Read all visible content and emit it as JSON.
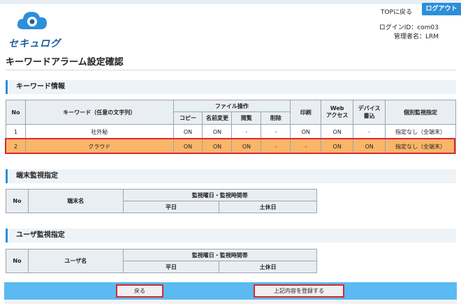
{
  "header": {
    "logo_text": "セキュログ",
    "top_link": "TOPに戻る",
    "logout": "ログアウト",
    "login_id": "ログインID：com03",
    "admin_name": "管理者名：LRM"
  },
  "page_title": "キーワードアラーム設定確認",
  "keyword_section": {
    "title": "キーワード情報",
    "headers": {
      "no": "No",
      "keyword": "キーワード（任意の文字列）",
      "file_ops": "ファイル操作",
      "copy": "コピー",
      "rename": "名前変更",
      "view": "閲覧",
      "delete": "削除",
      "print": "印刷",
      "web_line1": "Web",
      "web_line2": "アクセス",
      "device_line1": "デバイス",
      "device_line2": "書込",
      "monitor": "個別監視指定"
    },
    "rows": [
      {
        "no": "1",
        "keyword": "社外秘",
        "copy": "ON",
        "rename": "ON",
        "view": "-",
        "delete": "-",
        "print": "ON",
        "web": "ON",
        "device": "-",
        "monitor": "指定なし（全端末）"
      },
      {
        "no": "2",
        "keyword": "クラウド",
        "copy": "ON",
        "rename": "ON",
        "view": "ON",
        "delete": "-",
        "print": "-",
        "web": "ON",
        "device": "ON",
        "monitor": "指定なし（全端末）"
      }
    ]
  },
  "terminal_section": {
    "title": "端末監視指定",
    "no": "No",
    "name": "端末名",
    "schedule": "監視曜日・監視時間帯",
    "weekday": "平日",
    "weekend": "土休日"
  },
  "user_section": {
    "title": "ユーザ監視指定",
    "no": "No",
    "name": "ユーザ名",
    "schedule": "監視曜日・監視時間帯",
    "weekday": "平日",
    "weekend": "土休日"
  },
  "buttons": {
    "back": "戻る",
    "register": "上記内容を登録する"
  },
  "colors": {
    "accent": "#2d8fd8",
    "highlight_row": "#f9b66a",
    "highlight_border": "#e0262d",
    "bottom_bar": "#5bbaf2"
  }
}
